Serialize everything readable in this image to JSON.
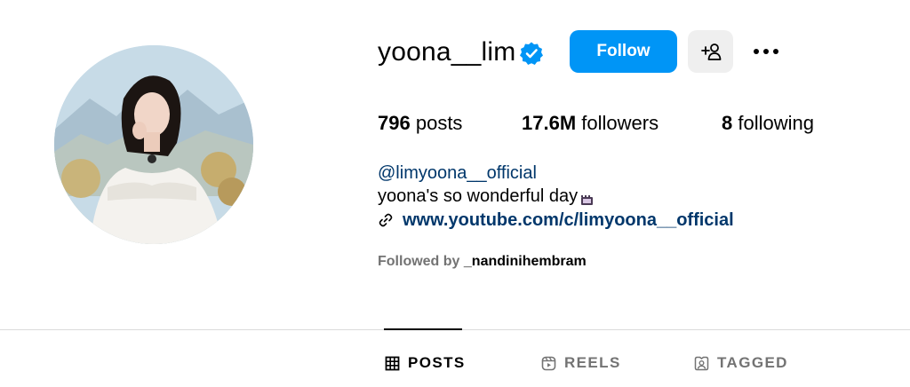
{
  "profile": {
    "username": "yoona__lim",
    "verified": true,
    "verified_icon": "verified-badge-icon",
    "accent_color": "#0095f6",
    "link_color": "#00376b"
  },
  "actions": {
    "follow_label": "Follow",
    "add_user_icon": "add-user-icon",
    "more_icon": "more-options-icon"
  },
  "stats": {
    "posts_count": "796",
    "posts_label": "posts",
    "followers_count": "17.6M",
    "followers_label": "followers",
    "following_count": "8",
    "following_label": "following"
  },
  "bio": {
    "handle": "@limyoona__official",
    "text": "yoona's so wonderful day",
    "emoji_icon": "film-emoji-icon",
    "website": "www.youtube.com/c/limyoona__official",
    "website_icon": "link-icon"
  },
  "followed_by": {
    "prefix": "Followed by",
    "user": "_nandinihembram"
  },
  "tabs": [
    {
      "label": "POSTS",
      "icon": "grid-icon",
      "active": true
    },
    {
      "label": "REELS",
      "icon": "reels-icon",
      "active": false
    },
    {
      "label": "TAGGED",
      "icon": "tagged-icon",
      "active": false
    }
  ]
}
